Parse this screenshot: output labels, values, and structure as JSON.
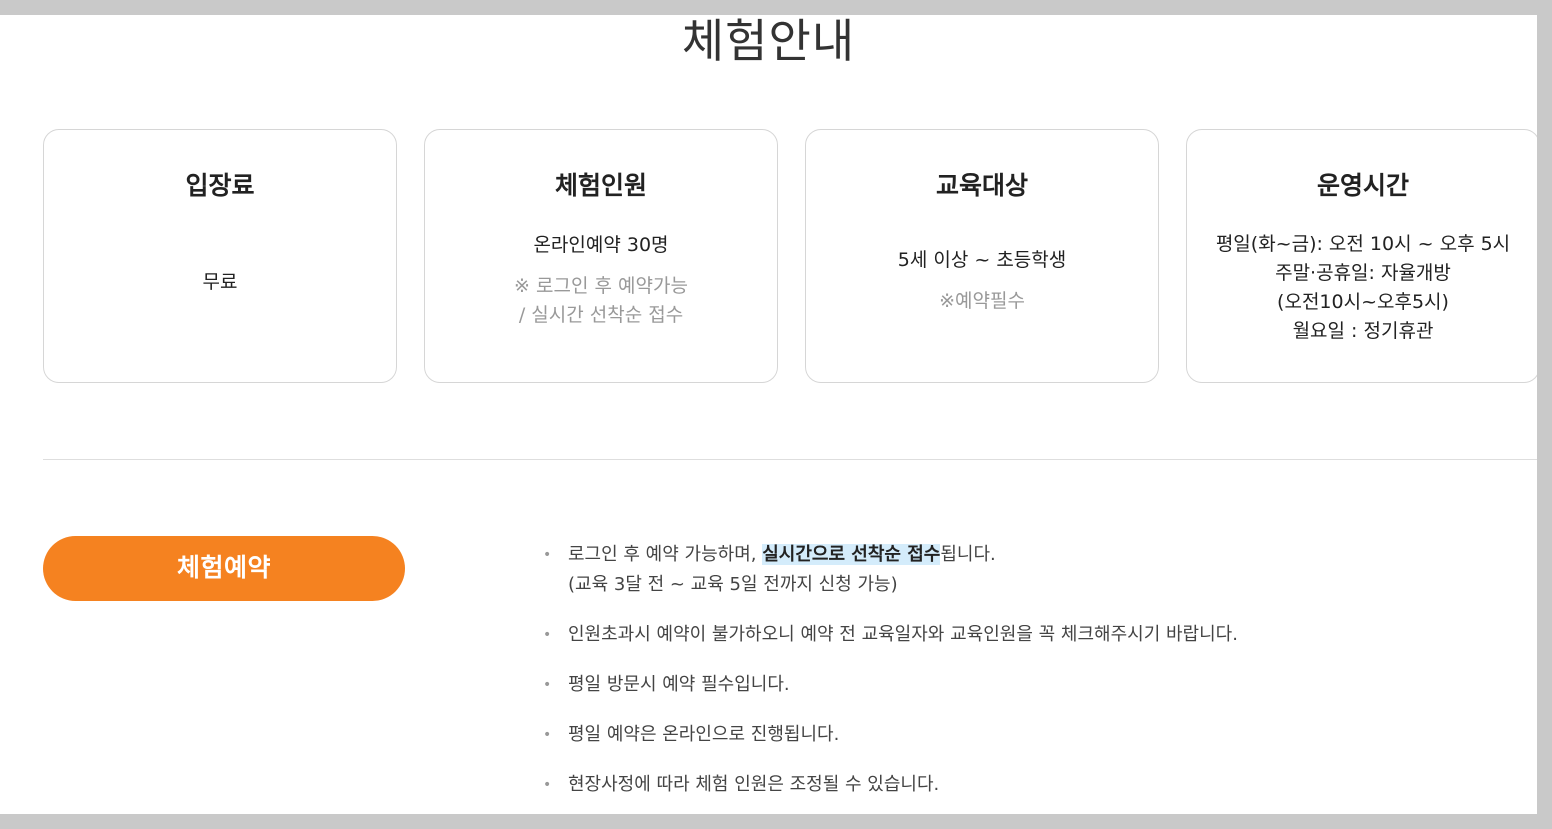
{
  "page": {
    "title": "체험안내"
  },
  "cards": [
    {
      "title": "입장료",
      "lines": [
        "무료"
      ],
      "notes": []
    },
    {
      "title": "체험인원",
      "lines": [
        "온라인예약 30명"
      ],
      "notes": [
        "※ 로그인 후 예약가능",
        "/ 실시간 선착순 접수"
      ]
    },
    {
      "title": "교육대상",
      "lines": [
        "5세 이상 ~ 초등학생"
      ],
      "notes": [
        "※예약필수"
      ]
    },
    {
      "title": "운영시간",
      "lines": [
        "평일(화~금): 오전 10시 ~ 오후 5시",
        "주말·공휴일: 자율개방",
        "(오전10시~오후5시)",
        "월요일 : 정기휴관"
      ],
      "notes": []
    }
  ],
  "reservation": {
    "button_label": "체험예약"
  },
  "notes": {
    "bullet": "•",
    "item1": {
      "before": "로그인 후 예약 가능하며, ",
      "highlight": "실시간으로 선착순 접수",
      "after": "됩니다.",
      "line2": "(교육 3달 전 ~ 교육 5일 전까지 신청 가능)"
    },
    "item2": "인원초과시 예약이 불가하오니 예약 전 교육일자와 교육인원을 꼭 체크해주시기 바랍니다.",
    "item3": "평일 방문시 예약 필수입니다.",
    "item4": "평일 예약은 온라인으로 진행됩니다.",
    "item5": "현장사정에 따라 체험 인원은 조정될 수 있습니다."
  },
  "colors": {
    "accent": "#f58220",
    "highlight": "#d4ecfb",
    "note_text": "#999999"
  }
}
